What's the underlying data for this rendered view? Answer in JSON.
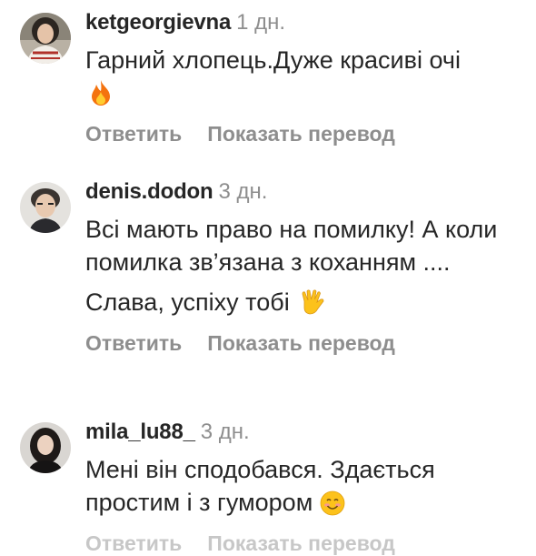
{
  "comments": [
    {
      "username": "ketgeorgievna",
      "time": "1 дн.",
      "avatar": "female-avatar",
      "paragraphs": [
        "Гарний хлопець.Дуже красиві очі"
      ],
      "emoji": "fire-icon"
    },
    {
      "username": "denis.dodon",
      "time": "3 дн.",
      "avatar": "male-avatar",
      "paragraphs": [
        "Всі мають право на помилку! А коли помилка зв’язана з коханням ....",
        "Слава, успіху тобі"
      ],
      "emoji": "vulcan-salute-icon"
    },
    {
      "username": "mila_lu88_",
      "time": "3 дн.",
      "avatar": "female-avatar",
      "paragraphs": [
        "Мені він сподобався. Здається простим і з гумором"
      ],
      "emoji": "smiling-face-icon"
    }
  ],
  "actions": {
    "reply_label": "Ответить",
    "translate_label": "Показать перевод"
  },
  "colors": {
    "username": "#262626",
    "muted": "#8e8e8e",
    "text": "#262626"
  }
}
